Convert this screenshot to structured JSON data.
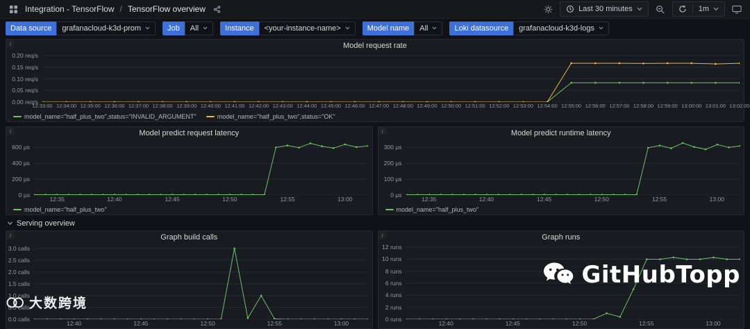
{
  "topbar": {
    "breadcrumb_folder": "Integration - TensorFlow",
    "separator": "/",
    "title": "TensorFlow overview",
    "time_range_label": "Last 30 minutes",
    "refresh_interval": "1m"
  },
  "filters": [
    {
      "label": "Data source",
      "value": "grafanacloud-k3d-prom"
    },
    {
      "label": "Job",
      "value": "All"
    },
    {
      "label": "Instance",
      "value": "<your-instance-name>"
    },
    {
      "label": "Model name",
      "value": "All"
    },
    {
      "label": "Loki datasource",
      "value": "grafanacloud-k3d-logs"
    }
  ],
  "row_header": {
    "label": "Serving overview"
  },
  "watermarks": {
    "github": "GitHubTopp",
    "bottom_left": "大数跨境"
  },
  "colors": {
    "green": "#73bf69",
    "yellow": "#eab839",
    "panel_bg": "#181b1f",
    "page_bg": "#111217",
    "filter_label_bg": "#3d71d9"
  },
  "chart_data": [
    {
      "type": "line",
      "title": "Model request rate",
      "y_min": 0,
      "y_max": 0.215,
      "y_ticks": [
        {
          "value": 0,
          "label": "0.00 req/s"
        },
        {
          "value": 0.05,
          "label": "0.05 req/s"
        },
        {
          "value": 0.1,
          "label": "0.10 req/s"
        },
        {
          "value": 0.15,
          "label": "0.15 req/s"
        },
        {
          "value": 0.2,
          "label": "0.20 req/s"
        }
      ],
      "x_ticks": [
        "12:33:00",
        "12:34:00",
        "12:35:00",
        "12:36:00",
        "12:37:00",
        "12:38:00",
        "12:39:00",
        "12:40:00",
        "12:41:00",
        "12:42:00",
        "12:43:00",
        "12:44:00",
        "12:45:00",
        "12:46:00",
        "12:47:00",
        "12:48:00",
        "12:49:00",
        "12:50:00",
        "12:51:00",
        "12:52:00",
        "12:53:00",
        "12:54:00",
        "12:55:00",
        "12:56:00",
        "12:57:00",
        "12:58:00",
        "12:59:00",
        "13:00:00",
        "13:01:00",
        "13:02:00"
      ],
      "series": [
        {
          "name": "model_name=\"half_plus_two\",status=\"INVALID_ARGUMENT\"",
          "color": "#73bf69",
          "values": [
            0,
            0,
            0,
            0,
            0,
            0,
            0,
            0,
            0,
            0,
            0,
            0,
            0,
            0,
            0,
            0,
            0,
            0,
            0,
            0,
            0,
            0,
            0.083,
            0.083,
            0.083,
            0.083,
            0.083,
            0.083,
            0.083,
            0.083
          ]
        },
        {
          "name": "model_name=\"half_plus_two\",status=\"OK\"",
          "color": "#eab839",
          "values": [
            0,
            0,
            0,
            0,
            0,
            0,
            0,
            0,
            0,
            0,
            0,
            0,
            0,
            0,
            0,
            0,
            0,
            0,
            0,
            0,
            0,
            0,
            0.167,
            0.167,
            0.167,
            0.166,
            0.167,
            0.167,
            0.164,
            0.167
          ]
        }
      ]
    },
    {
      "type": "line",
      "title": "Model predict request latency",
      "y_min": 0,
      "y_max": 700,
      "y_ticks": [
        {
          "value": 0,
          "label": "0 µs"
        },
        {
          "value": 200,
          "label": "200 µs"
        },
        {
          "value": 400,
          "label": "400 µs"
        },
        {
          "value": 600,
          "label": "600 µs"
        }
      ],
      "x_ticks": [
        "12:35",
        "12:40",
        "12:45",
        "12:50",
        "12:55",
        "13:00"
      ],
      "x_tick_positions": [
        0.069,
        0.241,
        0.414,
        0.586,
        0.759,
        0.931
      ],
      "series": [
        {
          "name": "model_name=\"half_plus_two\"",
          "color": "#73bf69",
          "values": [
            4,
            4,
            4,
            4,
            4,
            4,
            4,
            4,
            4,
            4,
            4,
            4,
            4,
            4,
            4,
            4,
            4,
            4,
            4,
            4,
            4,
            600,
            625,
            598,
            652,
            615,
            592,
            638,
            605,
            620
          ]
        }
      ]
    },
    {
      "type": "line",
      "title": "Model predict runtime latency",
      "y_min": 0,
      "y_max": 350,
      "y_ticks": [
        {
          "value": 0,
          "label": "0 µs"
        },
        {
          "value": 100,
          "label": "100 µs"
        },
        {
          "value": 200,
          "label": "200 µs"
        },
        {
          "value": 300,
          "label": "300 µs"
        }
      ],
      "x_ticks": [
        "12:35",
        "12:40",
        "12:45",
        "12:50",
        "12:55",
        "13:00"
      ],
      "x_tick_positions": [
        0.069,
        0.241,
        0.414,
        0.586,
        0.759,
        0.931
      ],
      "series": [
        {
          "name": "model_name=\"half_plus_two\"",
          "color": "#73bf69",
          "values": [
            2,
            2,
            2,
            2,
            2,
            2,
            2,
            2,
            2,
            2,
            2,
            2,
            2,
            2,
            2,
            2,
            2,
            2,
            2,
            2,
            2,
            298,
            312,
            295,
            328,
            303,
            288,
            318,
            300,
            310
          ]
        }
      ]
    },
    {
      "type": "line",
      "title": "Graph build calls",
      "y_min": 0,
      "y_max": 3.2,
      "y_ticks": [
        {
          "value": 0,
          "label": "0.0 calls"
        },
        {
          "value": 0.5,
          "label": "0.5 calls"
        },
        {
          "value": 1,
          "label": "1.0 calls"
        },
        {
          "value": 1.5,
          "label": "1.5 calls"
        },
        {
          "value": 2,
          "label": "2.0 calls"
        },
        {
          "value": 2.5,
          "label": "2.5 calls"
        },
        {
          "value": 3,
          "label": "3.0 calls"
        }
      ],
      "x_ticks": [
        "12:40",
        "12:45",
        "12:50",
        "12:55",
        "13:00"
      ],
      "x_tick_positions": [
        0.12,
        0.32,
        0.52,
        0.72,
        0.92
      ],
      "series": [
        {
          "color": "#73bf69",
          "values": [
            0,
            0,
            0,
            0,
            0,
            0,
            0,
            0,
            0,
            0,
            0,
            0,
            0,
            0,
            0,
            3,
            0.05,
            1,
            0.02,
            0,
            0,
            0,
            0,
            0,
            0,
            0
          ]
        }
      ]
    },
    {
      "type": "line",
      "title": "Graph runs",
      "y_min": 0,
      "y_max": 12.6,
      "y_ticks": [
        {
          "value": 0,
          "label": "0 runs"
        },
        {
          "value": 2,
          "label": "2 runs"
        },
        {
          "value": 4,
          "label": "4 runs"
        },
        {
          "value": 6,
          "label": "6 runs"
        },
        {
          "value": 8,
          "label": "8 runs"
        },
        {
          "value": 10,
          "label": "10 runs"
        },
        {
          "value": 12,
          "label": "12 runs"
        }
      ],
      "x_ticks": [
        "12:40",
        "12:45",
        "12:50",
        "12:55",
        "13:00"
      ],
      "x_tick_positions": [
        0.12,
        0.32,
        0.52,
        0.72,
        0.92
      ],
      "series": [
        {
          "color": "#73bf69",
          "values": [
            0,
            0,
            0,
            0,
            0,
            0,
            0,
            0,
            0,
            0,
            0,
            0,
            0,
            0,
            0,
            1,
            0.4,
            5,
            10,
            10,
            10.3,
            10,
            10,
            10.3,
            10,
            10
          ]
        }
      ]
    }
  ]
}
